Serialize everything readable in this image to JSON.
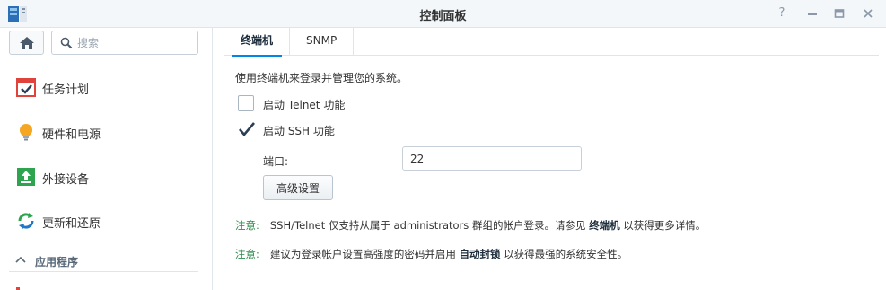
{
  "window": {
    "title": "控制面板",
    "help_symbol": "?"
  },
  "sidebar": {
    "search_placeholder": "搜索",
    "items": [
      {
        "label": "任务计划",
        "icon": "calendar-check-icon"
      },
      {
        "label": "硬件和电源",
        "icon": "lightbulb-icon"
      },
      {
        "label": "外接设备",
        "icon": "external-device-icon"
      },
      {
        "label": "更新和还原",
        "icon": "refresh-icon"
      }
    ],
    "section": {
      "label": "应用程序",
      "icon": "chevron-up-icon"
    }
  },
  "tabs": [
    {
      "label": "终端机",
      "active": true
    },
    {
      "label": "SNMP",
      "active": false
    }
  ],
  "terminal": {
    "description": "使用终端机来登录并管理您的系统。",
    "telnet": {
      "label": "启动 Telnet 功能",
      "checked": false
    },
    "ssh": {
      "label": "启动 SSH 功能",
      "checked": true
    },
    "port_label": "端口:",
    "port_value": "22",
    "advanced_button": "高级设置"
  },
  "notes": [
    {
      "key": "注意:",
      "text_before": "SSH/Telnet 仅支持从属于 administrators 群组的帐户登录。请参见",
      "link": "终端机",
      "text_after": "以获得更多详情。"
    },
    {
      "key": "注意:",
      "text_before": "建议为登录帐户设置高强度的密码并启用",
      "link": "自动封锁",
      "text_after": "以获得最强的系统安全性。"
    }
  ],
  "colors": {
    "accent": "#0086e5",
    "note_key": "#2b8a4a",
    "check": "#2a3f55"
  }
}
